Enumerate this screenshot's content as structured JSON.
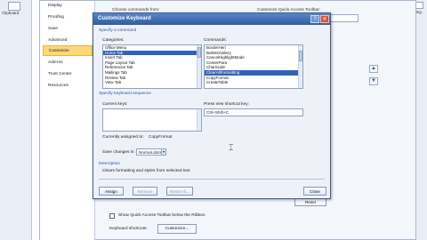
{
  "left_edge": {
    "label": "Clipboard"
  },
  "right_edge": {
    "label": "Editing"
  },
  "word_options": {
    "nav": [
      "Display",
      "Proofing",
      "Save",
      "Advanced",
      "Customize",
      "Add-Ins",
      "Trust Center",
      "Resources"
    ],
    "nav_selected": 4,
    "choose_commands_label": "Choose commands from:",
    "customize_qat_label": "Customize Quick Access Toolbar:",
    "reset_label": "Reset",
    "show_qat_below_label": "Show Quick Access Toolbar below the Ribbon",
    "keyboard_shortcuts_label": "Keyboard shortcuts:",
    "customize_label": "Customize..."
  },
  "dialog": {
    "title": "Customize Keyboard",
    "help_glyph": "?",
    "close_glyph": "✕",
    "specify_command": "Specify a command",
    "categories_label": "Categories:",
    "categories": [
      "Office Menu",
      "Home Tab",
      "Insert Tab",
      "Page Layout Tab",
      "References Tab",
      "Mailings Tab",
      "Review Tab",
      "View Tab"
    ],
    "categories_selected": 1,
    "commands_label": "Commands:",
    "commands": [
      "BorderHeri",
      "BulletsGallery",
      "CancelHighlightMode",
      "CenterPara",
      "CharScale",
      "ClearAllFormatting",
      "CopyFormat",
      "CreateTable"
    ],
    "commands_selected": 5,
    "specify_sequence": "Specify keyboard sequence",
    "current_keys_label": "Current keys:",
    "press_new_label": "Press new shortcut key:",
    "new_shortcut_value": "Ctrl+Shift+C",
    "assigned_label": "Currently assigned to:",
    "assigned_value": "CopyFormat",
    "save_changes_label": "Save changes in:",
    "save_changes_value": "Normal.dotm",
    "description_label": "Description",
    "description_text": "Clears formatting and styles from selected text",
    "assign_label": "Assign",
    "remove_label": "Remove",
    "reset_all_label": "Reset All...",
    "close_label": "Close"
  }
}
